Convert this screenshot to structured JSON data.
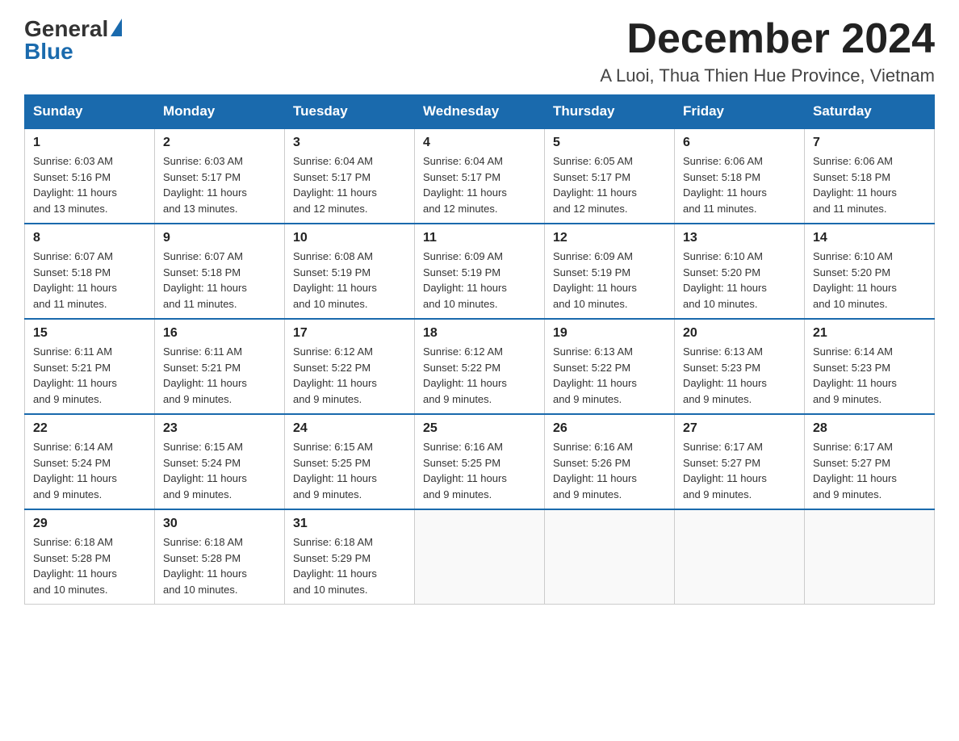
{
  "logo": {
    "general": "General",
    "blue": "Blue"
  },
  "header": {
    "month_year": "December 2024",
    "location": "A Luoi, Thua Thien Hue Province, Vietnam"
  },
  "days_of_week": [
    "Sunday",
    "Monday",
    "Tuesday",
    "Wednesday",
    "Thursday",
    "Friday",
    "Saturday"
  ],
  "weeks": [
    [
      {
        "day": "1",
        "sunrise": "6:03 AM",
        "sunset": "5:16 PM",
        "daylight": "11 hours and 13 minutes."
      },
      {
        "day": "2",
        "sunrise": "6:03 AM",
        "sunset": "5:17 PM",
        "daylight": "11 hours and 13 minutes."
      },
      {
        "day": "3",
        "sunrise": "6:04 AM",
        "sunset": "5:17 PM",
        "daylight": "11 hours and 12 minutes."
      },
      {
        "day": "4",
        "sunrise": "6:04 AM",
        "sunset": "5:17 PM",
        "daylight": "11 hours and 12 minutes."
      },
      {
        "day": "5",
        "sunrise": "6:05 AM",
        "sunset": "5:17 PM",
        "daylight": "11 hours and 12 minutes."
      },
      {
        "day": "6",
        "sunrise": "6:06 AM",
        "sunset": "5:18 PM",
        "daylight": "11 hours and 11 minutes."
      },
      {
        "day": "7",
        "sunrise": "6:06 AM",
        "sunset": "5:18 PM",
        "daylight": "11 hours and 11 minutes."
      }
    ],
    [
      {
        "day": "8",
        "sunrise": "6:07 AM",
        "sunset": "5:18 PM",
        "daylight": "11 hours and 11 minutes."
      },
      {
        "day": "9",
        "sunrise": "6:07 AM",
        "sunset": "5:18 PM",
        "daylight": "11 hours and 11 minutes."
      },
      {
        "day": "10",
        "sunrise": "6:08 AM",
        "sunset": "5:19 PM",
        "daylight": "11 hours and 10 minutes."
      },
      {
        "day": "11",
        "sunrise": "6:09 AM",
        "sunset": "5:19 PM",
        "daylight": "11 hours and 10 minutes."
      },
      {
        "day": "12",
        "sunrise": "6:09 AM",
        "sunset": "5:19 PM",
        "daylight": "11 hours and 10 minutes."
      },
      {
        "day": "13",
        "sunrise": "6:10 AM",
        "sunset": "5:20 PM",
        "daylight": "11 hours and 10 minutes."
      },
      {
        "day": "14",
        "sunrise": "6:10 AM",
        "sunset": "5:20 PM",
        "daylight": "11 hours and 10 minutes."
      }
    ],
    [
      {
        "day": "15",
        "sunrise": "6:11 AM",
        "sunset": "5:21 PM",
        "daylight": "11 hours and 9 minutes."
      },
      {
        "day": "16",
        "sunrise": "6:11 AM",
        "sunset": "5:21 PM",
        "daylight": "11 hours and 9 minutes."
      },
      {
        "day": "17",
        "sunrise": "6:12 AM",
        "sunset": "5:22 PM",
        "daylight": "11 hours and 9 minutes."
      },
      {
        "day": "18",
        "sunrise": "6:12 AM",
        "sunset": "5:22 PM",
        "daylight": "11 hours and 9 minutes."
      },
      {
        "day": "19",
        "sunrise": "6:13 AM",
        "sunset": "5:22 PM",
        "daylight": "11 hours and 9 minutes."
      },
      {
        "day": "20",
        "sunrise": "6:13 AM",
        "sunset": "5:23 PM",
        "daylight": "11 hours and 9 minutes."
      },
      {
        "day": "21",
        "sunrise": "6:14 AM",
        "sunset": "5:23 PM",
        "daylight": "11 hours and 9 minutes."
      }
    ],
    [
      {
        "day": "22",
        "sunrise": "6:14 AM",
        "sunset": "5:24 PM",
        "daylight": "11 hours and 9 minutes."
      },
      {
        "day": "23",
        "sunrise": "6:15 AM",
        "sunset": "5:24 PM",
        "daylight": "11 hours and 9 minutes."
      },
      {
        "day": "24",
        "sunrise": "6:15 AM",
        "sunset": "5:25 PM",
        "daylight": "11 hours and 9 minutes."
      },
      {
        "day": "25",
        "sunrise": "6:16 AM",
        "sunset": "5:25 PM",
        "daylight": "11 hours and 9 minutes."
      },
      {
        "day": "26",
        "sunrise": "6:16 AM",
        "sunset": "5:26 PM",
        "daylight": "11 hours and 9 minutes."
      },
      {
        "day": "27",
        "sunrise": "6:17 AM",
        "sunset": "5:27 PM",
        "daylight": "11 hours and 9 minutes."
      },
      {
        "day": "28",
        "sunrise": "6:17 AM",
        "sunset": "5:27 PM",
        "daylight": "11 hours and 9 minutes."
      }
    ],
    [
      {
        "day": "29",
        "sunrise": "6:18 AM",
        "sunset": "5:28 PM",
        "daylight": "11 hours and 10 minutes."
      },
      {
        "day": "30",
        "sunrise": "6:18 AM",
        "sunset": "5:28 PM",
        "daylight": "11 hours and 10 minutes."
      },
      {
        "day": "31",
        "sunrise": "6:18 AM",
        "sunset": "5:29 PM",
        "daylight": "11 hours and 10 minutes."
      },
      null,
      null,
      null,
      null
    ]
  ],
  "labels": {
    "sunrise": "Sunrise:",
    "sunset": "Sunset:",
    "daylight": "Daylight:"
  }
}
